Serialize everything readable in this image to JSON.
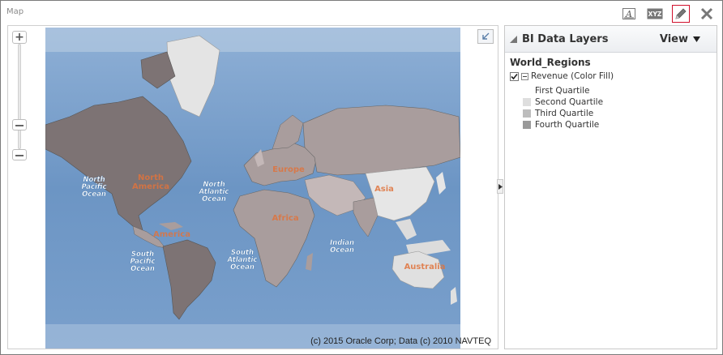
{
  "view": {
    "title": "Map"
  },
  "toolbar": {
    "format_icon": "format-text-icon",
    "rename_icon": "xyz-rename-icon",
    "edit_icon": "pencil-icon",
    "close_icon": "close-icon"
  },
  "map": {
    "copyright": "(c) 2015 Oracle Corp; Data (c) 2010 NAVTEQ",
    "labels": {
      "north_pacific": [
        "North",
        "Pacific",
        "Ocean"
      ],
      "north_america": [
        "North",
        "America"
      ],
      "north_atlantic": [
        "North",
        "Atlantic",
        "Ocean"
      ],
      "europe": "Europe",
      "asia": "Asia",
      "africa": "Africa",
      "south_america": "America",
      "south_pacific": [
        "South",
        "Pacific",
        "Ocean"
      ],
      "south_atlantic": [
        "South",
        "Atlantic",
        "Ocean"
      ],
      "indian": [
        "Indian",
        "Ocean"
      ],
      "australia": "Australia"
    },
    "zoom": {
      "in_label": "+",
      "level_fraction": 0.83
    }
  },
  "panel": {
    "title": "BI Data Layers",
    "view_menu": "View",
    "layer_name": "World_Regions",
    "layer_checked": true,
    "layer_label": "Revenue (Color Fill)",
    "legend": [
      {
        "label": "First Quartile",
        "color": "#ffffff"
      },
      {
        "label": "Second Quartile",
        "color": "#dedede"
      },
      {
        "label": "Third Quartile",
        "color": "#bdbdbd"
      },
      {
        "label": "Fourth Quartile",
        "color": "#9a9a9a"
      }
    ]
  },
  "colors": {
    "ocean": "#6c95c4",
    "land_q1": "#e6e6e6",
    "land_q2": "#c4b8b8",
    "land_q3": "#a99d9d",
    "land_q4": "#7d7374",
    "accent_selected": "#d0102c",
    "label_orange": "#e0733c"
  }
}
